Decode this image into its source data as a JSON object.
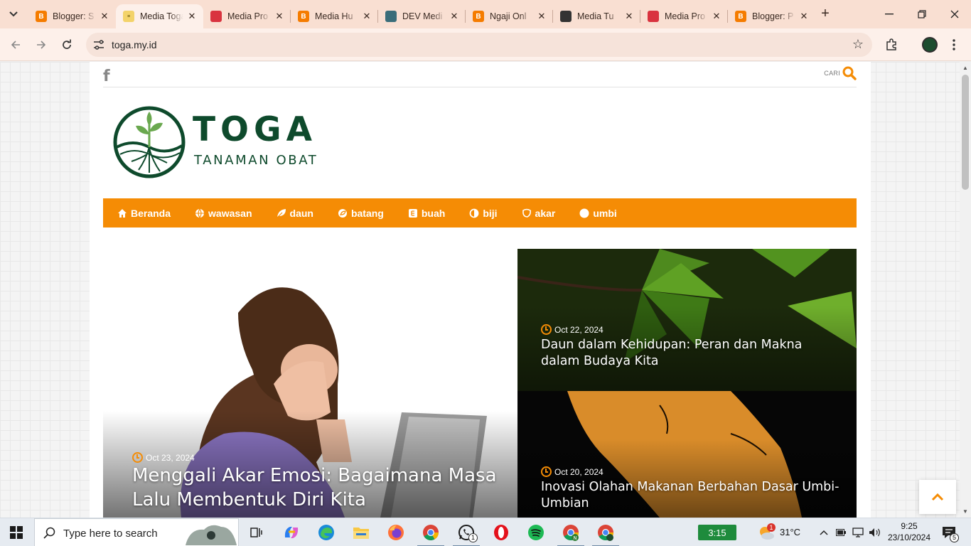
{
  "browser": {
    "tabs": [
      {
        "title": "Blogger: S",
        "favicon": "blogger-icon",
        "active": false
      },
      {
        "title": "Media Toga",
        "favicon": "toga-site-icon",
        "active": true
      },
      {
        "title": "Media Pro",
        "favicon": "media-pro-icon",
        "active": false
      },
      {
        "title": "Media Hu",
        "favicon": "blogger-icon",
        "active": false
      },
      {
        "title": "DEV Medi",
        "favicon": "dev-media-icon",
        "active": false
      },
      {
        "title": "Ngaji Onl",
        "favicon": "blogger-icon",
        "active": false
      },
      {
        "title": "Media Tu",
        "favicon": "media-tu-icon",
        "active": false
      },
      {
        "title": "Media Pro",
        "favicon": "media-pro-icon",
        "active": false
      },
      {
        "title": "Blogger: P",
        "favicon": "blogger-icon",
        "active": false
      }
    ],
    "url": "toga.my.id"
  },
  "site": {
    "search_label": "CARI",
    "brand": "TOGA",
    "tagline": "TANAMAN OBAT",
    "nav": [
      {
        "label": "Beranda",
        "icon": "home-icon"
      },
      {
        "label": "wawasan",
        "icon": "globe-icon"
      },
      {
        "label": "daun",
        "icon": "leaf-icon"
      },
      {
        "label": "batang",
        "icon": "envira-icon"
      },
      {
        "label": "buah",
        "icon": "fruit-icon"
      },
      {
        "label": "biji",
        "icon": "seed-icon"
      },
      {
        "label": "akar",
        "icon": "root-icon"
      },
      {
        "label": "umbi",
        "icon": "circle-icon"
      }
    ],
    "featured": [
      {
        "date": "Oct 23, 2024",
        "title": "Menggali Akar Emosi: Bagaimana Masa Lalu Membentuk Diri Kita"
      },
      {
        "date": "Oct 22, 2024",
        "title": "Daun dalam Kehidupan: Peran dan Makna dalam Budaya Kita"
      },
      {
        "date": "Oct 20, 2024",
        "title": "Inovasi Olahan Makanan Berbahan Dasar Umbi-Umbian"
      }
    ]
  },
  "taskbar": {
    "search_placeholder": "Type here to search",
    "battery": "3:15",
    "weather": "31°C",
    "time": "9:25",
    "date": "23/10/2024",
    "notifications": "5",
    "whatsapp_badge": "1",
    "weather_badge": "1"
  },
  "colors": {
    "accent": "#f58c05",
    "brand_green": "#0e4a2c",
    "tab_strip": "#f9dfd2"
  }
}
